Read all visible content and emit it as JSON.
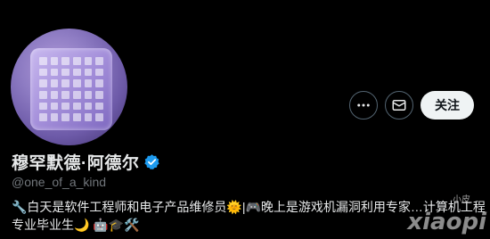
{
  "profile": {
    "display_name": "穆罕默德·阿德尔",
    "handle": "@one_of_a_kind",
    "verified": true,
    "bio_line1": "🔧白天是软件工程师和电子产品维修员🌞|🎮晚上是游戏机漏洞利用专家…计算机工程",
    "bio_line2": "专业毕业生🌙 🤖🎓🛠️"
  },
  "actions": {
    "more_icon": "more-dots-icon",
    "message_icon": "envelope-icon",
    "follow_label": "关注"
  },
  "colors": {
    "background": "#000000",
    "verified_blue": "#1d9bf0",
    "muted_text": "#71767b"
  },
  "watermark": {
    "small": "小皮",
    "large": "xiaopi"
  }
}
